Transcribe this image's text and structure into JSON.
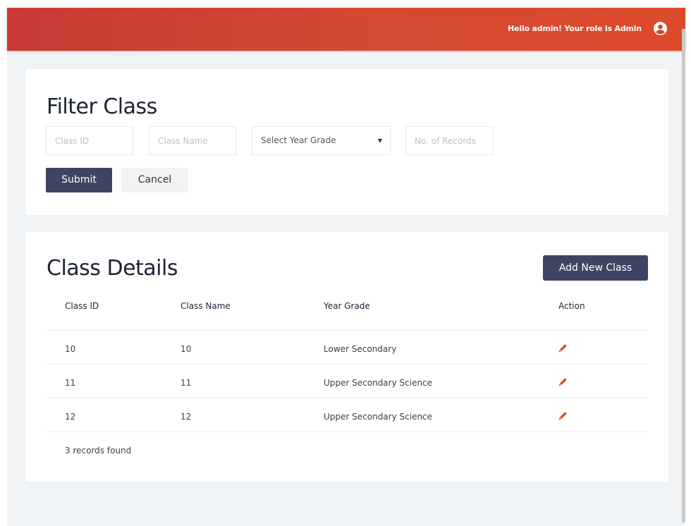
{
  "header": {
    "greeting": "Hello admin! Your role is Admin",
    "user_icon": "user-circle-icon",
    "colors": {
      "gradient_start": "#c73a35",
      "gradient_end": "#dd4a2b"
    }
  },
  "filter": {
    "title": "Filter Class",
    "fields": {
      "class_id_placeholder": "Class ID",
      "class_name_placeholder": "Class Name",
      "year_grade_selected": "Select Year Grade",
      "records_placeholder": "No. of Records"
    },
    "submit_label": "Submit",
    "cancel_label": "Cancel"
  },
  "details": {
    "title": "Class Details",
    "add_button_label": "Add New Class",
    "columns": [
      "Class ID",
      "Class Name",
      "Year Grade",
      "Action"
    ],
    "rows": [
      {
        "class_id": "10",
        "class_name": "10",
        "year_grade": "Lower Secondary",
        "action_icon": "pencil-icon"
      },
      {
        "class_id": "11",
        "class_name": "11",
        "year_grade": "Upper Secondary Science",
        "action_icon": "pencil-icon"
      },
      {
        "class_id": "12",
        "class_name": "12",
        "year_grade": "Upper Secondary Science",
        "action_icon": "pencil-icon"
      }
    ],
    "records_found": "3 records found"
  },
  "colors": {
    "primary": "#3e4562",
    "accent": "#e0411f"
  }
}
